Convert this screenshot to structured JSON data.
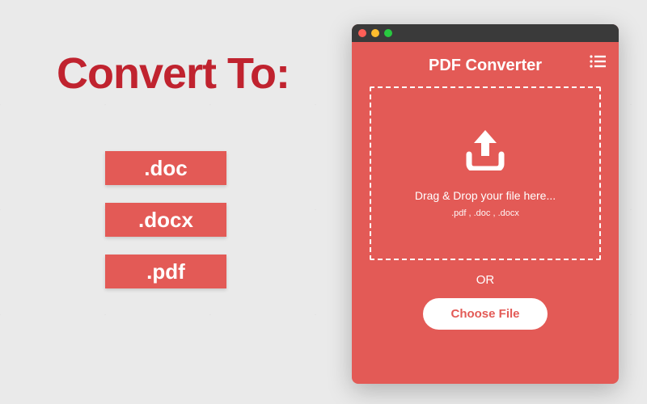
{
  "headline": "Convert To:",
  "formats": [
    {
      "label": ".doc"
    },
    {
      "label": ".docx"
    },
    {
      "label": ".pdf"
    }
  ],
  "app": {
    "title": "PDF Converter",
    "drop_text": "Drag & Drop your file here...",
    "accepted_formats": ".pdf , .doc , .docx",
    "or_label": "OR",
    "choose_file_label": "Choose File"
  },
  "colors": {
    "accent": "#e35a56",
    "headline": "#c0232f"
  }
}
